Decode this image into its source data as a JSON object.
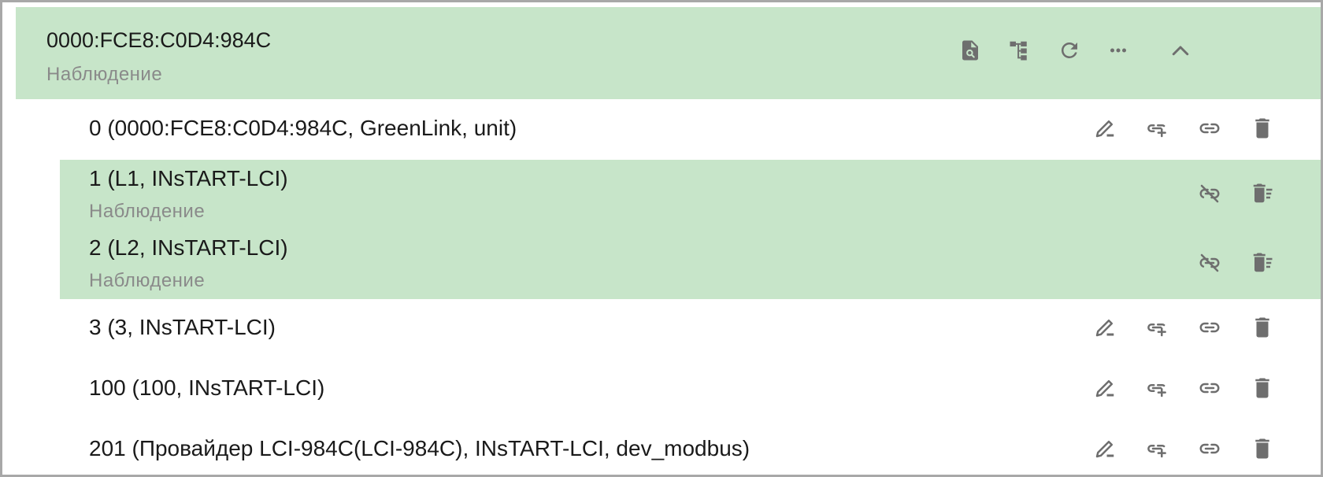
{
  "header": {
    "title": "0000:FCE8:C0D4:984C",
    "subtitle": "Наблюдение",
    "icons": [
      "document-search-icon",
      "tree-structure-icon",
      "refresh-icon",
      "more-horizontal-icon",
      "chevron-up-icon"
    ]
  },
  "rows": [
    {
      "label": "0 (0000:FCE8:C0D4:984C, GreenLink, unit)",
      "subtitle": "",
      "highlighted": false
    },
    {
      "label": "1 (L1, INsTART-LCI)",
      "subtitle": "Наблюдение",
      "highlighted": true
    },
    {
      "label": "2 (L2, INsTART-LCI)",
      "subtitle": "Наблюдение",
      "highlighted": true
    },
    {
      "label": "3 (3, INsTART-LCI)",
      "subtitle": "",
      "highlighted": false
    },
    {
      "label": "100 (100, INsTART-LCI)",
      "subtitle": "",
      "highlighted": false
    },
    {
      "label": "201 (Провайдер LCI-984C(LCI-984C), INsTART-LCI, dev_modbus)",
      "subtitle": "",
      "highlighted": false
    }
  ],
  "colors": {
    "highlight": "#c7e5c9",
    "icon": "#6e6e6e",
    "subtitle": "#8a8a8a",
    "border": "#a8a8a8"
  }
}
